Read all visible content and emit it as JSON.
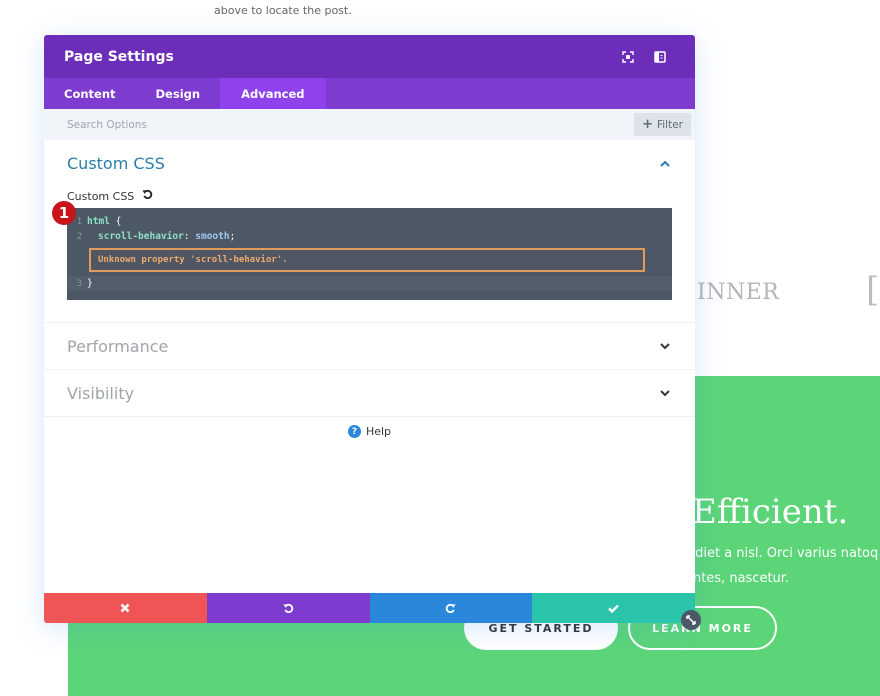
{
  "background": {
    "note_text": "above to locate the post.",
    "logo_text": "INNER",
    "bracket_text": "[",
    "hero": {
      "title": "Efficient.",
      "line1": "erdiet a nisl. Orci varius natoq",
      "line2": "ontes, nascetur.",
      "primary_button": "GET STARTED",
      "secondary_button": "LEARN MORE",
      "color": "#5cd579"
    }
  },
  "modal": {
    "title": "Page Settings",
    "header_icons": [
      "expand-icon",
      "sidebar-toggle-icon"
    ],
    "tabs": [
      {
        "label": "Content",
        "active": false
      },
      {
        "label": "Design",
        "active": false
      },
      {
        "label": "Advanced",
        "active": true
      }
    ],
    "search": {
      "placeholder": "Search Options",
      "value": ""
    },
    "filter_label": "Filter",
    "sections": {
      "custom_css": {
        "title": "Custom CSS",
        "expanded": true,
        "field_label": "Custom CSS",
        "badge": "1",
        "code": {
          "line1_no": "1",
          "line1_selector": "html",
          "line1_brace": " {",
          "line2_no": "2",
          "line2_prop": "scroll-behavior",
          "line2_colon": ": ",
          "line2_value": "smooth",
          "line2_semi": ";",
          "error": "Unknown property 'scroll-behavior'.",
          "line3_no": "3",
          "line3_brace": "}"
        }
      },
      "performance": {
        "title": "Performance",
        "expanded": false
      },
      "visibility": {
        "title": "Visibility",
        "expanded": false
      }
    },
    "help_label": "Help",
    "footer": {
      "cancel_color": "#ef5555",
      "undo_color": "#7e3bd0",
      "redo_color": "#2b87da",
      "save_color": "#29c4a9"
    },
    "colors": {
      "header": "#6c2eb9",
      "tabs": "#7e3bd0",
      "active_tab": "#8f42ec"
    }
  }
}
